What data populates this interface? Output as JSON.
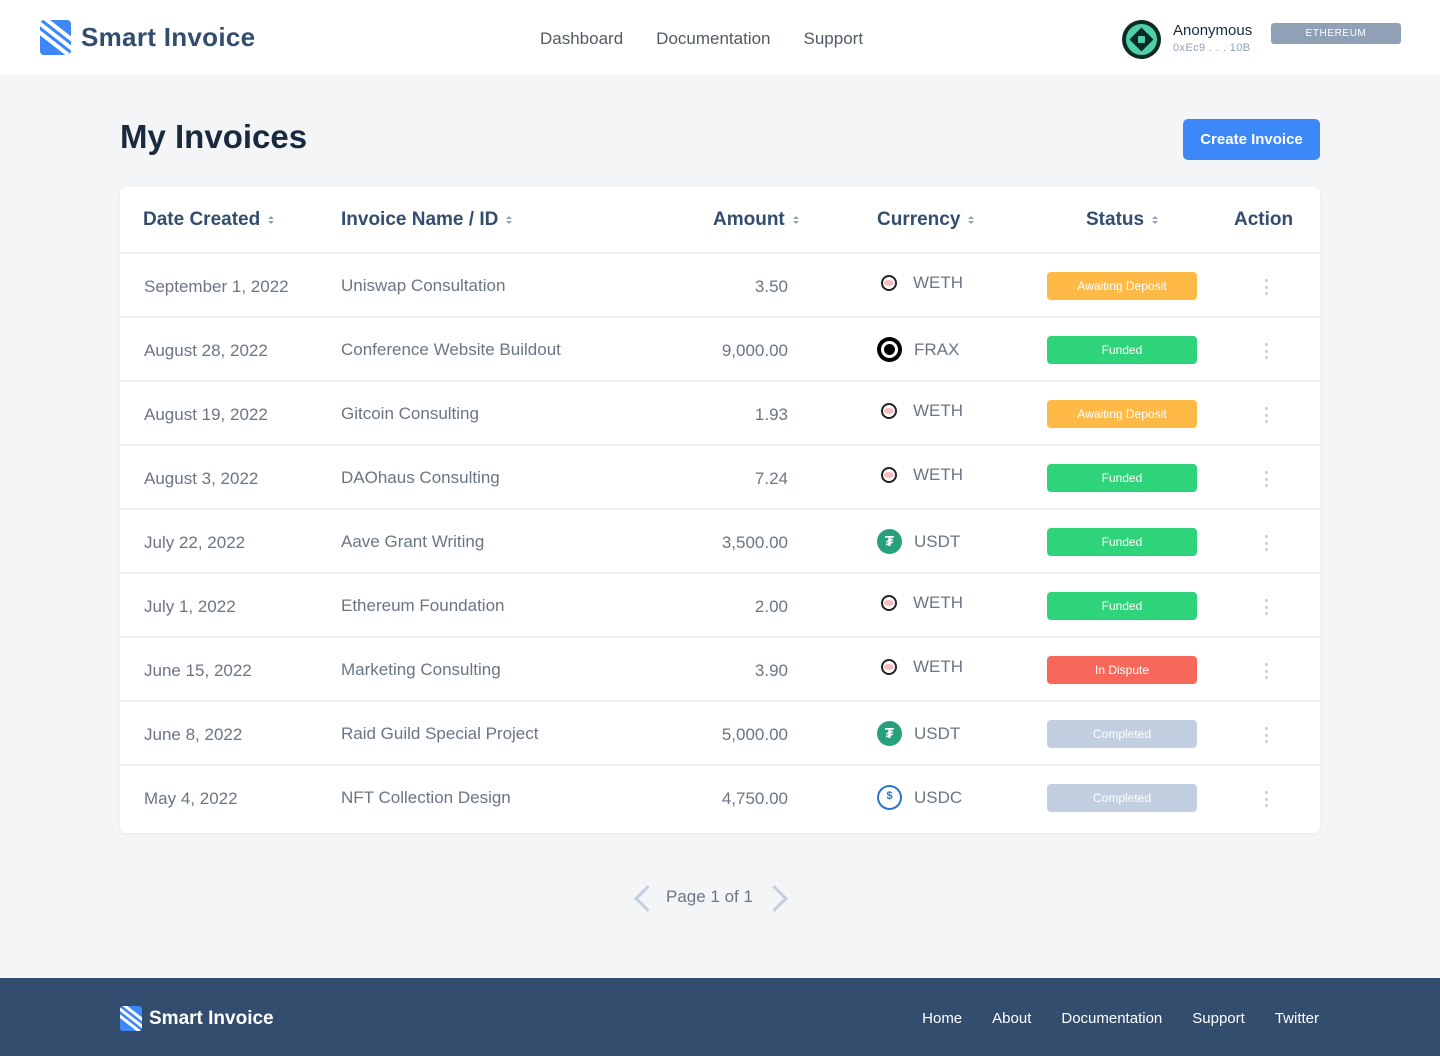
{
  "header": {
    "brand": "Smart Invoice",
    "nav": [
      "Dashboard",
      "Documentation",
      "Support"
    ],
    "account": {
      "name": "Anonymous",
      "address": "0xEc9 . . . 10B"
    },
    "network": "ETHEREUM"
  },
  "page": {
    "title": "My Invoices",
    "create_label": "Create Invoice"
  },
  "table": {
    "columns": {
      "date": "Date Created",
      "name": "Invoice Name / ID",
      "amount": "Amount",
      "currency": "Currency",
      "status": "Status",
      "action": "Action"
    },
    "rows": [
      {
        "date": "September 1, 2022",
        "name": "Uniswap Consultation",
        "amount": "3.50",
        "currency": "WETH",
        "coin": "weth-icon",
        "status": "Awaiting Deposit"
      },
      {
        "date": "August 28, 2022",
        "name": "Conference Website Buildout",
        "amount": "9,000.00",
        "currency": "FRAX",
        "coin": "frax-icon",
        "status": "Funded"
      },
      {
        "date": "August 19, 2022",
        "name": "Gitcoin Consulting",
        "amount": "1.93",
        "currency": "WETH",
        "coin": "weth-icon",
        "status": "Awaiting Deposit"
      },
      {
        "date": "August 3, 2022",
        "name": "DAOhaus Consulting",
        "amount": "7.24",
        "currency": "WETH",
        "coin": "weth-icon",
        "status": "Funded"
      },
      {
        "date": "July 22, 2022",
        "name": "Aave Grant Writing",
        "amount": "3,500.00",
        "currency": "USDT",
        "coin": "usdt-icon",
        "status": "Funded"
      },
      {
        "date": "July 1, 2022",
        "name": "Ethereum Foundation",
        "amount": "2.00",
        "currency": "WETH",
        "coin": "weth-icon",
        "status": "Funded"
      },
      {
        "date": "June 15, 2022",
        "name": "Marketing Consulting",
        "amount": "3.90",
        "currency": "WETH",
        "coin": "weth-icon",
        "status": "In Dispute"
      },
      {
        "date": "June 8, 2022",
        "name": "Raid Guild Special Project",
        "amount": "5,000.00",
        "currency": "USDT",
        "coin": "usdt-icon",
        "status": "Completed"
      },
      {
        "date": "May 4, 2022",
        "name": "NFT Collection Design",
        "amount": "4,750.00",
        "currency": "USDC",
        "coin": "usdc-icon",
        "status": "Completed"
      }
    ]
  },
  "status_colors": {
    "Awaiting Deposit": "#ffb946",
    "Funded": "#2ed47a",
    "In Dispute": "#f7685b",
    "Completed": "#c2cfe0"
  },
  "pagination": {
    "label": "Page 1 of 1"
  },
  "footer": {
    "brand": "Smart Invoice",
    "links": [
      "Home",
      "About",
      "Documentation",
      "Support",
      "Twitter"
    ]
  },
  "colors": {
    "accent": "#3d88f8",
    "footer_bg": "#334d6e"
  }
}
